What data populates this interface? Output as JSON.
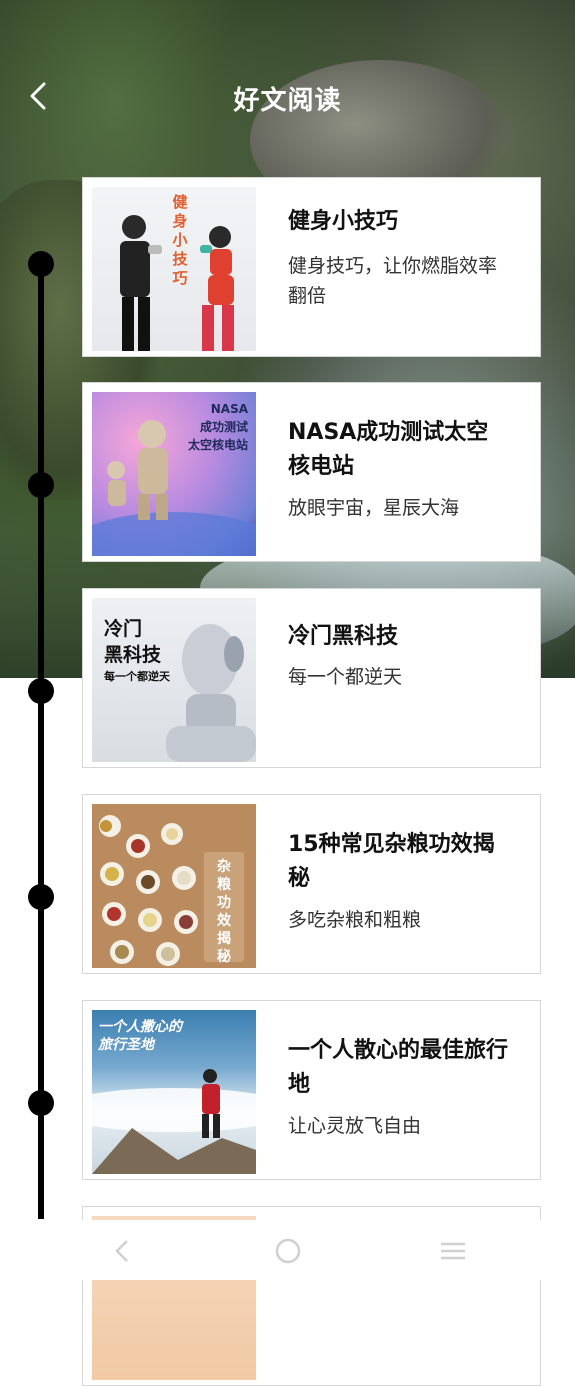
{
  "header": {
    "title": "好文阅读",
    "back_icon": "back-chevron-icon"
  },
  "articles": [
    {
      "title": "健身小技巧",
      "subtitle": "健身技巧，让你燃脂效率翻倍",
      "thumb_text": [
        "健",
        "身",
        "小",
        "技",
        "巧"
      ]
    },
    {
      "title": "NASA成功测试太空核电站",
      "subtitle": "放眼宇宙，星辰大海",
      "thumb_text": [
        "NASA",
        "成功测试",
        "太空核电站"
      ]
    },
    {
      "title": "冷门黑科技",
      "subtitle": "每一个都逆天",
      "thumb_text": [
        "冷门",
        "黑科技",
        "每一个都逆天"
      ]
    },
    {
      "title": "15种常见杂粮功效揭秘",
      "subtitle": "多吃杂粮和粗粮",
      "thumb_text": [
        "杂",
        "粮",
        "功",
        "效",
        "揭",
        "秘"
      ]
    },
    {
      "title": "一个人散心的最佳旅行地",
      "subtitle": "让心灵放飞自由",
      "thumb_text": [
        "一个人撒心的",
        "旅行圣地"
      ]
    }
  ],
  "nav": {
    "back": "nav-back-icon",
    "home": "nav-home-icon",
    "menu": "nav-menu-icon"
  },
  "colors": {
    "accent_red": "#e0402f",
    "title_text": "#111111",
    "timeline": "#000000"
  }
}
